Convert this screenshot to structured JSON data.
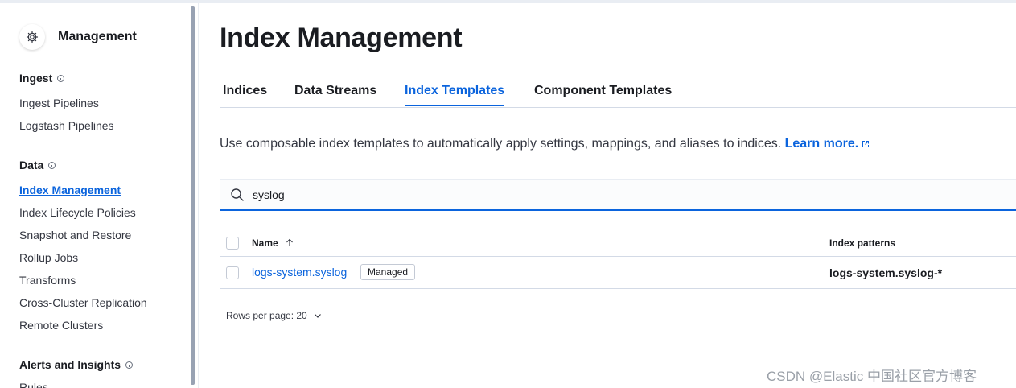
{
  "sidebar": {
    "title": "Management",
    "sections": [
      {
        "label": "Ingest",
        "items": [
          "Ingest Pipelines",
          "Logstash Pipelines"
        ]
      },
      {
        "label": "Data",
        "items": [
          "Index Management",
          "Index Lifecycle Policies",
          "Snapshot and Restore",
          "Rollup Jobs",
          "Transforms",
          "Cross-Cluster Replication",
          "Remote Clusters"
        ]
      },
      {
        "label": "Alerts and Insights",
        "items": [
          "Rules"
        ]
      }
    ],
    "active_item": "Index Management"
  },
  "main": {
    "title": "Index Management",
    "tabs": [
      {
        "label": "Indices"
      },
      {
        "label": "Data Streams"
      },
      {
        "label": "Index Templates"
      },
      {
        "label": "Component Templates"
      }
    ],
    "selected_tab": "Index Templates",
    "description": "Use composable index templates to automatically apply settings, mappings, and aliases to indices.",
    "learn_more": "Learn more.",
    "search": {
      "value": "syslog"
    },
    "table": {
      "columns": [
        "Name",
        "Index patterns"
      ],
      "rows": [
        {
          "name": "logs-system.syslog",
          "badge": "Managed",
          "index_patterns": "logs-system.syslog-*"
        }
      ]
    },
    "rows_per_page": "Rows per page: 20"
  },
  "watermark": "CSDN @Elastic 中国社区官方博客",
  "colors": {
    "accent": "#0b64dd",
    "text": "#1a1c21",
    "border": "#d3dae6"
  }
}
